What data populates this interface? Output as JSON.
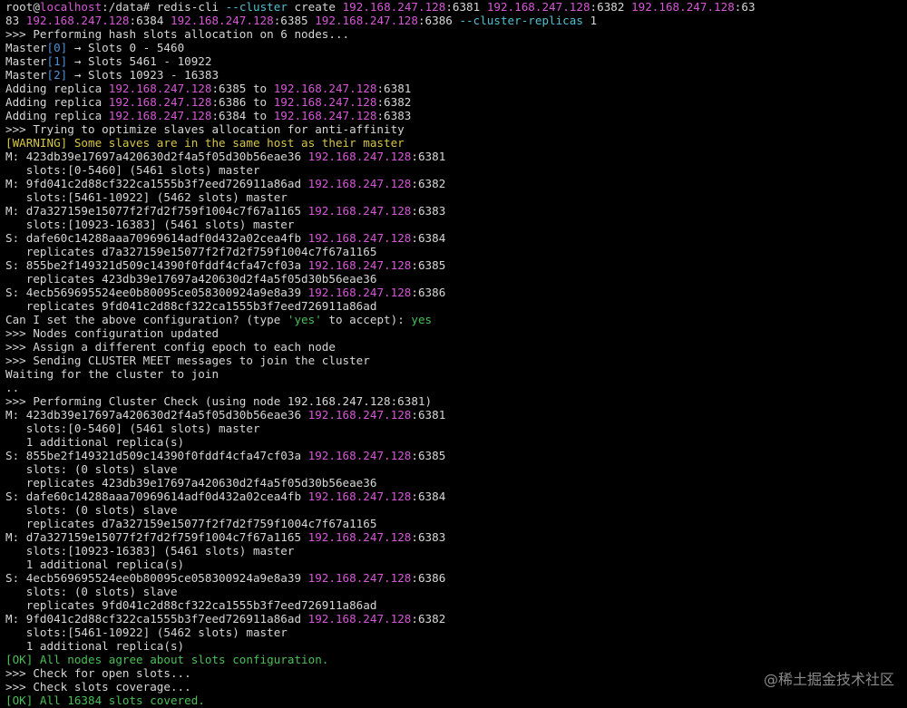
{
  "palette": {
    "default": "#d6d6d6",
    "magenta": "#d658d6",
    "cyan": "#52bfd1",
    "yellow": "#d7c645",
    "green": "#4bbf57",
    "index": "#4f8fd6",
    "background": "#000000"
  },
  "watermark": "@稀土掘金技术社区",
  "lines": [
    {
      "name": "line-command",
      "interactable": true,
      "segs": [
        [
          "default",
          "root@"
        ],
        [
          "magenta",
          "localhost"
        ],
        [
          "default",
          ":/data# redis-cli "
        ],
        [
          "cyan",
          "--cluster"
        ],
        [
          "default",
          " create "
        ],
        [
          "magenta",
          "192.168.247.128"
        ],
        [
          "default",
          ":6381 "
        ],
        [
          "magenta",
          "192.168.247.128"
        ],
        [
          "default",
          ":6382 "
        ],
        [
          "magenta",
          "192.168.247.128"
        ],
        [
          "default",
          ":63"
        ]
      ]
    },
    {
      "name": "line-command-cont",
      "interactable": true,
      "segs": [
        [
          "default",
          "83 "
        ],
        [
          "magenta",
          "192.168.247.128"
        ],
        [
          "default",
          ":6384 "
        ],
        [
          "magenta",
          "192.168.247.128"
        ],
        [
          "default",
          ":6385 "
        ],
        [
          "magenta",
          "192.168.247.128"
        ],
        [
          "default",
          ":6386 "
        ],
        [
          "cyan",
          "--cluster-replicas"
        ],
        [
          "default",
          " 1"
        ]
      ]
    },
    {
      "name": "line-output",
      "segs": [
        [
          "default",
          ">>> Performing hash slots allocation on 6 nodes..."
        ]
      ]
    },
    {
      "name": "line-output",
      "segs": [
        [
          "default",
          "Master"
        ],
        [
          "index",
          "[0]"
        ],
        [
          "default",
          " → Slots 0 - 5460"
        ]
      ]
    },
    {
      "name": "line-output",
      "segs": [
        [
          "default",
          "Master"
        ],
        [
          "index",
          "[1]"
        ],
        [
          "default",
          " → Slots 5461 - 10922"
        ]
      ]
    },
    {
      "name": "line-output",
      "segs": [
        [
          "default",
          "Master"
        ],
        [
          "index",
          "[2]"
        ],
        [
          "default",
          " → Slots 10923 - 16383"
        ]
      ]
    },
    {
      "name": "line-output",
      "segs": [
        [
          "default",
          "Adding replica "
        ],
        [
          "magenta",
          "192.168.247.128"
        ],
        [
          "default",
          ":6385 to "
        ],
        [
          "magenta",
          "192.168.247.128"
        ],
        [
          "default",
          ":6381"
        ]
      ]
    },
    {
      "name": "line-output",
      "segs": [
        [
          "default",
          "Adding replica "
        ],
        [
          "magenta",
          "192.168.247.128"
        ],
        [
          "default",
          ":6386 to "
        ],
        [
          "magenta",
          "192.168.247.128"
        ],
        [
          "default",
          ":6382"
        ]
      ]
    },
    {
      "name": "line-output",
      "segs": [
        [
          "default",
          "Adding replica "
        ],
        [
          "magenta",
          "192.168.247.128"
        ],
        [
          "default",
          ":6384 to "
        ],
        [
          "magenta",
          "192.168.247.128"
        ],
        [
          "default",
          ":6383"
        ]
      ]
    },
    {
      "name": "line-output",
      "segs": [
        [
          "default",
          ">>> Trying to optimize slaves allocation for anti-affinity"
        ]
      ]
    },
    {
      "name": "line-warning",
      "segs": [
        [
          "yellow",
          "[WARNING] Some slaves are in the same host as their master"
        ]
      ]
    },
    {
      "name": "line-output",
      "segs": [
        [
          "default",
          "M: 423db39e17697a420630d2f4a5f05d30b56eae36 "
        ],
        [
          "magenta",
          "192.168.247.128"
        ],
        [
          "default",
          ":6381"
        ]
      ]
    },
    {
      "name": "line-output",
      "segs": [
        [
          "default",
          "   slots:[0-5460] (5461 slots) master"
        ]
      ]
    },
    {
      "name": "line-output",
      "segs": [
        [
          "default",
          "M: 9fd041c2d88cf322ca1555b3f7eed726911a86ad "
        ],
        [
          "magenta",
          "192.168.247.128"
        ],
        [
          "default",
          ":6382"
        ]
      ]
    },
    {
      "name": "line-output",
      "segs": [
        [
          "default",
          "   slots:[5461-10922] (5462 slots) master"
        ]
      ]
    },
    {
      "name": "line-output",
      "segs": [
        [
          "default",
          "M: d7a327159e15077f2f7d2f759f1004c7f67a1165 "
        ],
        [
          "magenta",
          "192.168.247.128"
        ],
        [
          "default",
          ":6383"
        ]
      ]
    },
    {
      "name": "line-output",
      "segs": [
        [
          "default",
          "   slots:[10923-16383] (5461 slots) master"
        ]
      ]
    },
    {
      "name": "line-output",
      "segs": [
        [
          "default",
          "S: dafe60c14288aaa70969614adf0d432a02cea4fb "
        ],
        [
          "magenta",
          "192.168.247.128"
        ],
        [
          "default",
          ":6384"
        ]
      ]
    },
    {
      "name": "line-output",
      "segs": [
        [
          "default",
          "   replicates d7a327159e15077f2f7d2f759f1004c7f67a1165"
        ]
      ]
    },
    {
      "name": "line-output",
      "segs": [
        [
          "default",
          "S: 855be2f149321d509c14390f0fddf4cfa47cf03a "
        ],
        [
          "magenta",
          "192.168.247.128"
        ],
        [
          "default",
          ":6385"
        ]
      ]
    },
    {
      "name": "line-output",
      "segs": [
        [
          "default",
          "   replicates 423db39e17697a420630d2f4a5f05d30b56eae36"
        ]
      ]
    },
    {
      "name": "line-output",
      "segs": [
        [
          "default",
          "S: 4ecb569695524ee0b80095ce058300924a9e8a39 "
        ],
        [
          "magenta",
          "192.168.247.128"
        ],
        [
          "default",
          ":6386"
        ]
      ]
    },
    {
      "name": "line-output",
      "segs": [
        [
          "default",
          "   replicates 9fd041c2d88cf322ca1555b3f7eed726911a86ad"
        ]
      ]
    },
    {
      "name": "line-prompt",
      "interactable": true,
      "segs": [
        [
          "default",
          "Can I set the above configuration? (type "
        ],
        [
          "green",
          "'yes'"
        ],
        [
          "default",
          " to accept): "
        ],
        [
          "green",
          "yes"
        ]
      ]
    },
    {
      "name": "line-output",
      "segs": [
        [
          "default",
          ">>> Nodes configuration updated"
        ]
      ]
    },
    {
      "name": "line-output",
      "segs": [
        [
          "default",
          ">>> Assign a different config epoch to each node"
        ]
      ]
    },
    {
      "name": "line-output",
      "segs": [
        [
          "default",
          ">>> Sending CLUSTER MEET messages to join the cluster"
        ]
      ]
    },
    {
      "name": "line-output",
      "segs": [
        [
          "default",
          "Waiting for the cluster to join"
        ]
      ]
    },
    {
      "name": "line-output",
      "segs": [
        [
          "default",
          ".."
        ]
      ]
    },
    {
      "name": "line-output",
      "segs": [
        [
          "default",
          ">>> Performing Cluster Check (using node 192.168.247.128:6381)"
        ]
      ]
    },
    {
      "name": "line-output",
      "segs": [
        [
          "default",
          "M: 423db39e17697a420630d2f4a5f05d30b56eae36 "
        ],
        [
          "magenta",
          "192.168.247.128"
        ],
        [
          "default",
          ":6381"
        ]
      ]
    },
    {
      "name": "line-output",
      "segs": [
        [
          "default",
          "   slots:[0-5460] (5461 slots) master"
        ]
      ]
    },
    {
      "name": "line-output",
      "segs": [
        [
          "default",
          "   1 additional replica(s)"
        ]
      ]
    },
    {
      "name": "line-output",
      "segs": [
        [
          "default",
          "S: 855be2f149321d509c14390f0fddf4cfa47cf03a "
        ],
        [
          "magenta",
          "192.168.247.128"
        ],
        [
          "default",
          ":6385"
        ]
      ]
    },
    {
      "name": "line-output",
      "segs": [
        [
          "default",
          "   slots: (0 slots) slave"
        ]
      ]
    },
    {
      "name": "line-output",
      "segs": [
        [
          "default",
          "   replicates 423db39e17697a420630d2f4a5f05d30b56eae36"
        ]
      ]
    },
    {
      "name": "line-output",
      "segs": [
        [
          "default",
          "S: dafe60c14288aaa70969614adf0d432a02cea4fb "
        ],
        [
          "magenta",
          "192.168.247.128"
        ],
        [
          "default",
          ":6384"
        ]
      ]
    },
    {
      "name": "line-output",
      "segs": [
        [
          "default",
          "   slots: (0 slots) slave"
        ]
      ]
    },
    {
      "name": "line-output",
      "segs": [
        [
          "default",
          "   replicates d7a327159e15077f2f7d2f759f1004c7f67a1165"
        ]
      ]
    },
    {
      "name": "line-output",
      "segs": [
        [
          "default",
          "M: d7a327159e15077f2f7d2f759f1004c7f67a1165 "
        ],
        [
          "magenta",
          "192.168.247.128"
        ],
        [
          "default",
          ":6383"
        ]
      ]
    },
    {
      "name": "line-output",
      "segs": [
        [
          "default",
          "   slots:[10923-16383] (5461 slots) master"
        ]
      ]
    },
    {
      "name": "line-output",
      "segs": [
        [
          "default",
          "   1 additional replica(s)"
        ]
      ]
    },
    {
      "name": "line-output",
      "segs": [
        [
          "default",
          "S: 4ecb569695524ee0b80095ce058300924a9e8a39 "
        ],
        [
          "magenta",
          "192.168.247.128"
        ],
        [
          "default",
          ":6386"
        ]
      ]
    },
    {
      "name": "line-output",
      "segs": [
        [
          "default",
          "   slots: (0 slots) slave"
        ]
      ]
    },
    {
      "name": "line-output",
      "segs": [
        [
          "default",
          "   replicates 9fd041c2d88cf322ca1555b3f7eed726911a86ad"
        ]
      ]
    },
    {
      "name": "line-output",
      "segs": [
        [
          "default",
          "M: 9fd041c2d88cf322ca1555b3f7eed726911a86ad "
        ],
        [
          "magenta",
          "192.168.247.128"
        ],
        [
          "default",
          ":6382"
        ]
      ]
    },
    {
      "name": "line-output",
      "segs": [
        [
          "default",
          "   slots:[5461-10922] (5462 slots) master"
        ]
      ]
    },
    {
      "name": "line-output",
      "segs": [
        [
          "default",
          "   1 additional replica(s)"
        ]
      ]
    },
    {
      "name": "line-ok",
      "segs": [
        [
          "green",
          "[OK] All nodes agree about slots configuration."
        ]
      ]
    },
    {
      "name": "line-output",
      "segs": [
        [
          "default",
          ">>> Check for open slots..."
        ]
      ]
    },
    {
      "name": "line-output",
      "segs": [
        [
          "default",
          ">>> Check slots coverage..."
        ]
      ]
    },
    {
      "name": "line-ok",
      "segs": [
        [
          "green",
          "[OK] All 16384 slots covered."
        ]
      ]
    }
  ]
}
